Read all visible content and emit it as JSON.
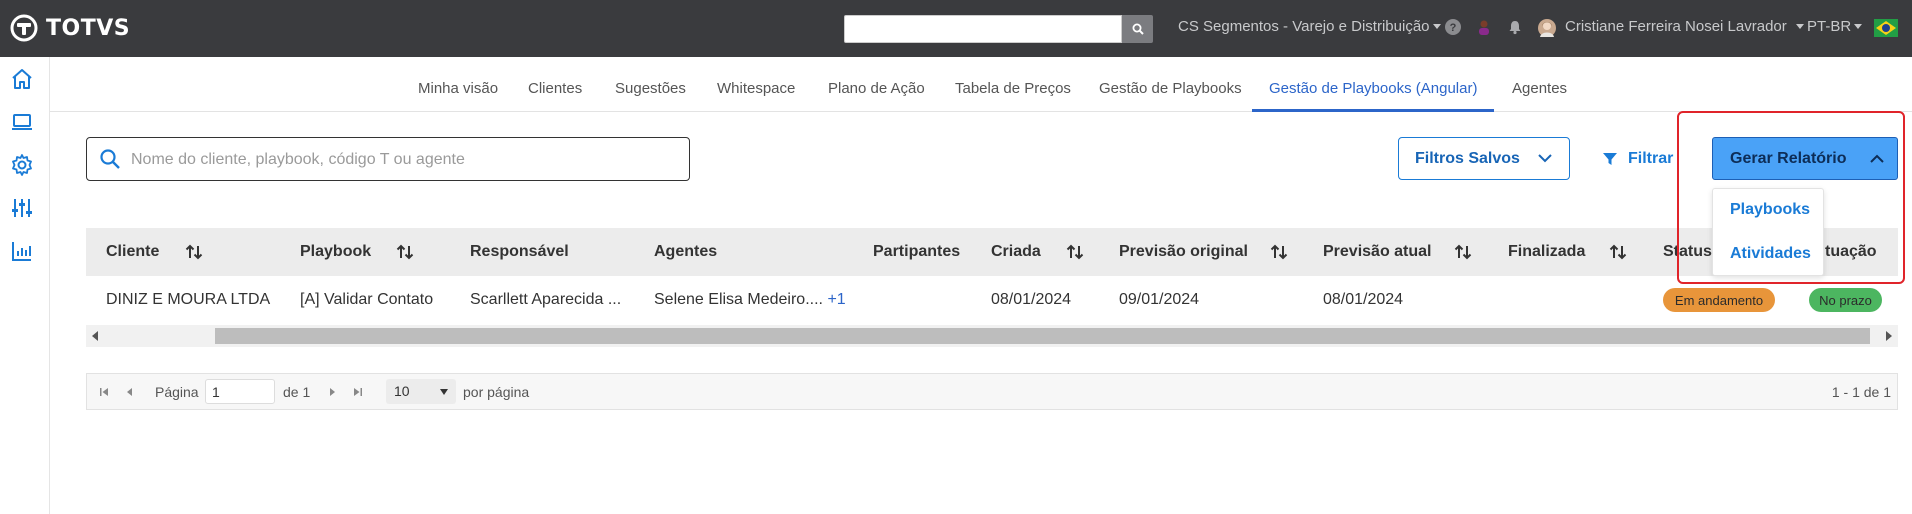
{
  "topbar": {
    "brand": "TOTVS",
    "search_value": "",
    "company": "CS Segmentos - Varejo e Distribuição",
    "user": "Cristiane Ferreira Nosei Lavrador",
    "language": "PT-BR",
    "help_icon": "question-circle-icon",
    "bell_icon": "bell-icon"
  },
  "tabs": [
    {
      "label": "Minha visão"
    },
    {
      "label": "Clientes"
    },
    {
      "label": "Sugestões"
    },
    {
      "label": "Whitespace"
    },
    {
      "label": "Plano de Ação"
    },
    {
      "label": "Tabela de Preços"
    },
    {
      "label": "Gestão de Playbooks"
    },
    {
      "label": "Gestão de Playbooks (Angular)",
      "active": true
    },
    {
      "label": "Agentes"
    }
  ],
  "search": {
    "placeholder": "Nome do cliente, playbook, código T ou agente",
    "value": ""
  },
  "toolbar": {
    "saved_filters": "Filtros Salvos",
    "filter": "Filtrar",
    "report": "Gerar Relatório"
  },
  "report_menu": [
    "Playbooks",
    "Atividades"
  ],
  "table": {
    "columns": [
      "Cliente",
      "Playbook",
      "Responsável",
      "Agentes",
      "Partipantes",
      "Criada",
      "Previsão original",
      "Previsão atual",
      "Finalizada",
      "Status",
      "Situação"
    ],
    "visible_situacao_header": "tuação",
    "rows": [
      {
        "cliente": "DINIZ E MOURA LTDA",
        "playbook": "[A] Validar Contato",
        "responsavel": "Scarllett Aparecida ...",
        "agentes": "Selene Elisa Medeiro....",
        "agentes_more": "+1",
        "participantes": "",
        "criada": "08/01/2024",
        "previsao_original": "09/01/2024",
        "previsao_atual": "08/01/2024",
        "finalizada": "",
        "status": "Em andamento",
        "situacao": "No prazo"
      }
    ]
  },
  "pagination": {
    "page_label": "Página",
    "page_value": "1",
    "of_label": "de 1",
    "per_page_value": "10",
    "per_page_label": "por página",
    "range": "1 - 1 de 1"
  },
  "colors": {
    "topbar": "#3a3b3e",
    "accent": "#1a7bd6",
    "active_tab": "#2c65c9",
    "status_in_progress": "#e8953a",
    "status_on_time": "#4cb660",
    "highlight": "#e0242a"
  }
}
